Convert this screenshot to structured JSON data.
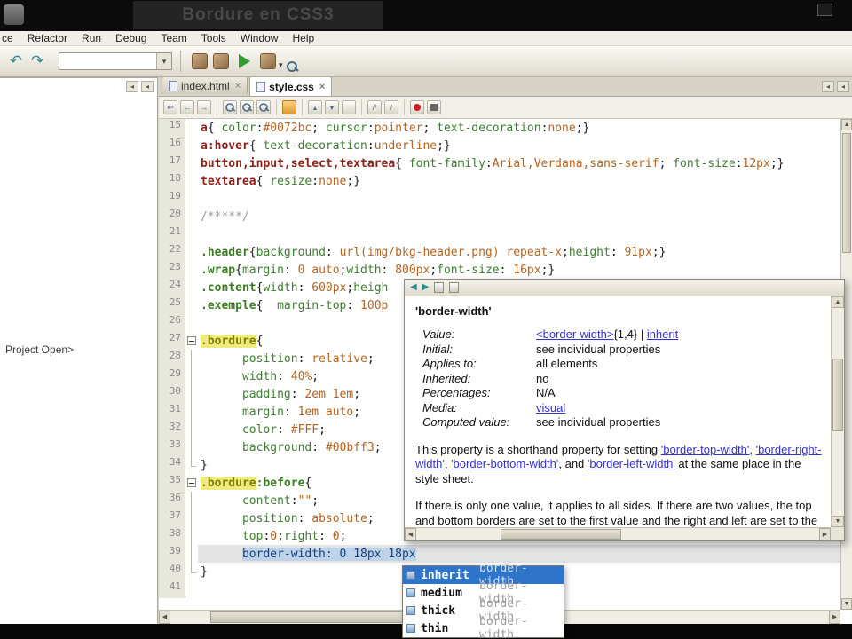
{
  "video": {
    "title": "Bordure en CSS3"
  },
  "menu": {
    "items": [
      "ce",
      "Refactor",
      "Run",
      "Debug",
      "Team",
      "Tools",
      "Window",
      "Help"
    ]
  },
  "sidebar": {
    "message": "Project Open>"
  },
  "tabs": [
    {
      "label": "index.html",
      "active": false
    },
    {
      "label": "style.css",
      "active": true
    }
  ],
  "icons": {
    "tab_close": "×",
    "scroll_up": "▲",
    "scroll_down": "▼",
    "scroll_left": "◀",
    "scroll_right": "▶"
  },
  "editor": {
    "lines": [
      {
        "n": 15,
        "fold": "",
        "segs": [
          {
            "c": "sel",
            "t": "a"
          },
          {
            "c": "pln",
            "t": "{ "
          },
          {
            "c": "prop",
            "t": "color"
          },
          {
            "c": "pln",
            "t": ":"
          },
          {
            "c": "val",
            "t": "#0072bc"
          },
          {
            "c": "pln",
            "t": "; "
          },
          {
            "c": "prop",
            "t": "cursor"
          },
          {
            "c": "pln",
            "t": ":"
          },
          {
            "c": "val",
            "t": "pointer"
          },
          {
            "c": "pln",
            "t": "; "
          },
          {
            "c": "prop",
            "t": "text-decoration"
          },
          {
            "c": "pln",
            "t": ":"
          },
          {
            "c": "val",
            "t": "none"
          },
          {
            "c": "pln",
            "t": ";}"
          }
        ]
      },
      {
        "n": 16,
        "fold": "",
        "segs": [
          {
            "c": "sel",
            "t": "a:hover"
          },
          {
            "c": "pln",
            "t": "{ "
          },
          {
            "c": "prop",
            "t": "text-decoration"
          },
          {
            "c": "pln",
            "t": ":"
          },
          {
            "c": "val",
            "t": "underline"
          },
          {
            "c": "pln",
            "t": ";}"
          }
        ]
      },
      {
        "n": 17,
        "fold": "",
        "segs": [
          {
            "c": "sel",
            "t": "button,input,select,textarea"
          },
          {
            "c": "pln",
            "t": "{ "
          },
          {
            "c": "prop",
            "t": "font-family"
          },
          {
            "c": "pln",
            "t": ":"
          },
          {
            "c": "val",
            "t": "Arial,Verdana,sans-serif"
          },
          {
            "c": "pln",
            "t": "; "
          },
          {
            "c": "prop",
            "t": "font-size"
          },
          {
            "c": "pln",
            "t": ":"
          },
          {
            "c": "val",
            "t": "12px"
          },
          {
            "c": "pln",
            "t": ";}"
          }
        ]
      },
      {
        "n": 18,
        "fold": "",
        "segs": [
          {
            "c": "sel",
            "t": "textarea"
          },
          {
            "c": "pln",
            "t": "{ "
          },
          {
            "c": "prop",
            "t": "resize"
          },
          {
            "c": "pln",
            "t": ":"
          },
          {
            "c": "val",
            "t": "none"
          },
          {
            "c": "pln",
            "t": ";}"
          }
        ]
      },
      {
        "n": 19,
        "fold": "",
        "segs": []
      },
      {
        "n": 20,
        "fold": "",
        "segs": [
          {
            "c": "com",
            "t": "/*****/"
          }
        ]
      },
      {
        "n": 21,
        "fold": "",
        "segs": []
      },
      {
        "n": 22,
        "fold": "",
        "segs": [
          {
            "c": "cls",
            "t": ".header"
          },
          {
            "c": "pln",
            "t": "{"
          },
          {
            "c": "prop",
            "t": "background"
          },
          {
            "c": "pln",
            "t": ": "
          },
          {
            "c": "val",
            "t": "url(img/bkg-header.png) repeat-x"
          },
          {
            "c": "pln",
            "t": ";"
          },
          {
            "c": "prop",
            "t": "height"
          },
          {
            "c": "pln",
            "t": ": "
          },
          {
            "c": "val",
            "t": "91px"
          },
          {
            "c": "pln",
            "t": ";}"
          }
        ]
      },
      {
        "n": 23,
        "fold": "",
        "segs": [
          {
            "c": "cls",
            "t": ".wrap"
          },
          {
            "c": "pln",
            "t": "{"
          },
          {
            "c": "prop",
            "t": "margin"
          },
          {
            "c": "pln",
            "t": ": "
          },
          {
            "c": "val",
            "t": "0 auto"
          },
          {
            "c": "pln",
            "t": ";"
          },
          {
            "c": "prop",
            "t": "width"
          },
          {
            "c": "pln",
            "t": ": "
          },
          {
            "c": "val",
            "t": "800px"
          },
          {
            "c": "pln",
            "t": ";"
          },
          {
            "c": "prop",
            "t": "font-size"
          },
          {
            "c": "pln",
            "t": ": "
          },
          {
            "c": "val",
            "t": "16px"
          },
          {
            "c": "pln",
            "t": ";}"
          }
        ]
      },
      {
        "n": 24,
        "fold": "",
        "segs": [
          {
            "c": "cls",
            "t": ".content"
          },
          {
            "c": "pln",
            "t": "{"
          },
          {
            "c": "prop",
            "t": "width"
          },
          {
            "c": "pln",
            "t": ": "
          },
          {
            "c": "val",
            "t": "600px"
          },
          {
            "c": "pln",
            "t": ";"
          },
          {
            "c": "prop",
            "t": "heigh"
          }
        ]
      },
      {
        "n": 25,
        "fold": "",
        "segs": [
          {
            "c": "cls",
            "t": ".exemple"
          },
          {
            "c": "pln",
            "t": "{  "
          },
          {
            "c": "prop",
            "t": "margin-top"
          },
          {
            "c": "pln",
            "t": ": "
          },
          {
            "c": "val",
            "t": "100p"
          }
        ]
      },
      {
        "n": 26,
        "fold": "",
        "segs": []
      },
      {
        "n": 27,
        "fold": "box",
        "segs": [
          {
            "c": "clshl",
            "t": ".bordure"
          },
          {
            "c": "pln",
            "t": "{"
          }
        ]
      },
      {
        "n": 28,
        "fold": "line",
        "segs": [
          {
            "c": "pln",
            "t": "      "
          },
          {
            "c": "prop",
            "t": "position"
          },
          {
            "c": "pln",
            "t": ": "
          },
          {
            "c": "val",
            "t": "relative"
          },
          {
            "c": "pln",
            "t": ";"
          }
        ]
      },
      {
        "n": 29,
        "fold": "line",
        "segs": [
          {
            "c": "pln",
            "t": "      "
          },
          {
            "c": "prop",
            "t": "width"
          },
          {
            "c": "pln",
            "t": ": "
          },
          {
            "c": "val",
            "t": "40%"
          },
          {
            "c": "pln",
            "t": ";"
          }
        ]
      },
      {
        "n": 30,
        "fold": "line",
        "segs": [
          {
            "c": "pln",
            "t": "      "
          },
          {
            "c": "prop",
            "t": "padding"
          },
          {
            "c": "pln",
            "t": ": "
          },
          {
            "c": "val",
            "t": "2em 1em"
          },
          {
            "c": "pln",
            "t": ";"
          }
        ]
      },
      {
        "n": 31,
        "fold": "line",
        "segs": [
          {
            "c": "pln",
            "t": "      "
          },
          {
            "c": "prop",
            "t": "margin"
          },
          {
            "c": "pln",
            "t": ": "
          },
          {
            "c": "val",
            "t": "1em auto"
          },
          {
            "c": "pln",
            "t": ";"
          }
        ]
      },
      {
        "n": 32,
        "fold": "line",
        "segs": [
          {
            "c": "pln",
            "t": "      "
          },
          {
            "c": "prop",
            "t": "color"
          },
          {
            "c": "pln",
            "t": ": "
          },
          {
            "c": "val",
            "t": "#FFF"
          },
          {
            "c": "pln",
            "t": ";"
          }
        ]
      },
      {
        "n": 33,
        "fold": "line",
        "segs": [
          {
            "c": "pln",
            "t": "      "
          },
          {
            "c": "prop",
            "t": "background"
          },
          {
            "c": "pln",
            "t": ": "
          },
          {
            "c": "val",
            "t": "#00bff3"
          },
          {
            "c": "pln",
            "t": ";"
          }
        ]
      },
      {
        "n": 34,
        "fold": "end",
        "segs": [
          {
            "c": "pln",
            "t": "}"
          }
        ]
      },
      {
        "n": 35,
        "fold": "box",
        "segs": [
          {
            "c": "clshl",
            "t": ".bordure"
          },
          {
            "c": "cls",
            "t": ":before"
          },
          {
            "c": "pln",
            "t": "{"
          }
        ]
      },
      {
        "n": 36,
        "fold": "line",
        "segs": [
          {
            "c": "pln",
            "t": "      "
          },
          {
            "c": "prop",
            "t": "content"
          },
          {
            "c": "pln",
            "t": ":"
          },
          {
            "c": "val",
            "t": "\"\""
          },
          {
            "c": "pln",
            "t": ";"
          }
        ]
      },
      {
        "n": 37,
        "fold": "line",
        "segs": [
          {
            "c": "pln",
            "t": "      "
          },
          {
            "c": "prop",
            "t": "position"
          },
          {
            "c": "pln",
            "t": ": "
          },
          {
            "c": "val",
            "t": "absolute"
          },
          {
            "c": "pln",
            "t": ";"
          }
        ]
      },
      {
        "n": 38,
        "fold": "line",
        "segs": [
          {
            "c": "pln",
            "t": "      "
          },
          {
            "c": "prop",
            "t": "top"
          },
          {
            "c": "pln",
            "t": ":"
          },
          {
            "c": "val",
            "t": "0"
          },
          {
            "c": "pln",
            "t": ";"
          },
          {
            "c": "prop",
            "t": "right"
          },
          {
            "c": "pln",
            "t": ": "
          },
          {
            "c": "val",
            "t": "0"
          },
          {
            "c": "pln",
            "t": ";"
          }
        ]
      },
      {
        "n": 39,
        "fold": "line",
        "cur": true,
        "segs": [
          {
            "c": "pln",
            "t": "      "
          },
          {
            "c": "selcode",
            "t": "border-width: 0 18px 18px"
          }
        ]
      },
      {
        "n": 40,
        "fold": "end",
        "segs": [
          {
            "c": "pln",
            "t": "}"
          }
        ]
      },
      {
        "n": 41,
        "fold": "",
        "segs": []
      }
    ]
  },
  "popup": {
    "title": "'border-width'",
    "rows": [
      {
        "label": "Value:",
        "segs": [
          {
            "c": "link",
            "t": "<border-width>"
          },
          {
            "c": "pln",
            "t": "{1,4} | "
          },
          {
            "c": "link",
            "t": "inherit"
          }
        ]
      },
      {
        "label": "Initial:",
        "segs": [
          {
            "c": "pln",
            "t": "see individual properties"
          }
        ]
      },
      {
        "label": "Applies to:",
        "segs": [
          {
            "c": "pln",
            "t": "all elements"
          }
        ]
      },
      {
        "label": "Inherited:",
        "segs": [
          {
            "c": "pln",
            "t": "no"
          }
        ]
      },
      {
        "label": "Percentages:",
        "segs": [
          {
            "c": "pln",
            "t": "N/A"
          }
        ]
      },
      {
        "label": "Media:",
        "segs": [
          {
            "c": "link",
            "t": "visual"
          }
        ]
      },
      {
        "label": "Computed value:",
        "segs": [
          {
            "c": "pln",
            "t": "see individual properties"
          }
        ]
      }
    ],
    "paragraphs": [
      {
        "segs": [
          {
            "c": "pln",
            "t": "This property is a shorthand property for setting "
          },
          {
            "c": "link",
            "t": "'border-top-width'"
          },
          {
            "c": "pln",
            "t": ", "
          },
          {
            "c": "link",
            "t": "'border-right-width'"
          },
          {
            "c": "pln",
            "t": ", "
          },
          {
            "c": "link",
            "t": "'border-bottom-width'"
          },
          {
            "c": "pln",
            "t": ", and "
          },
          {
            "c": "link",
            "t": "'border-left-width'"
          },
          {
            "c": "pln",
            "t": " at the same place in the style sheet."
          }
        ]
      },
      {
        "segs": [
          {
            "c": "pln",
            "t": "If there is only one value, it applies to all sides. If there are two values, the top and bottom borders are set to the first value and the right and left are set to the second."
          }
        ]
      }
    ]
  },
  "completion": {
    "items": [
      {
        "value": "inherit",
        "detail": "border-width",
        "selected": true
      },
      {
        "value": "medium",
        "detail": "border-width",
        "selected": false
      },
      {
        "value": "thick",
        "detail": "border-width",
        "selected": false
      },
      {
        "value": "thin",
        "detail": "border-width",
        "selected": false
      }
    ]
  },
  "colors": {
    "selection": "#2e74c8",
    "occurrence_highlight": "#eeea7e",
    "link": "#3333cc"
  }
}
